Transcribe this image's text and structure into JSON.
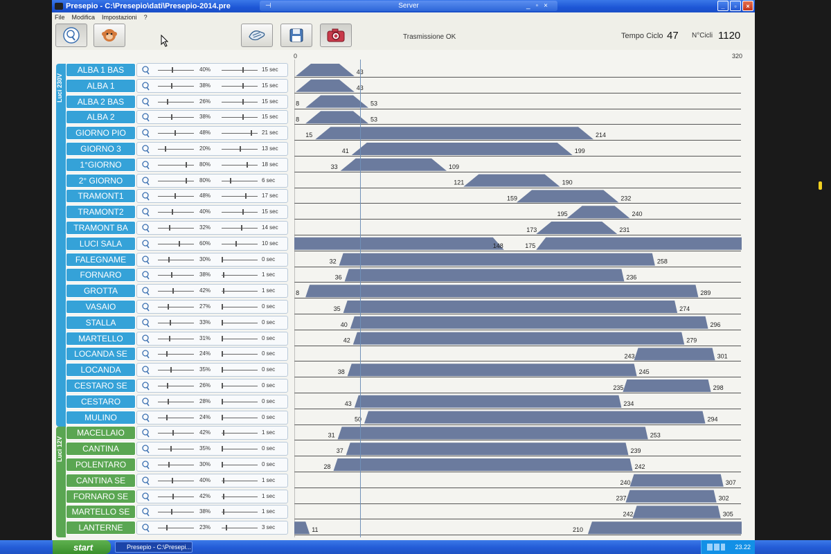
{
  "window": {
    "title": "Presepio - C:\\Presepio\\dati\\Presepio-2014.pre",
    "server_title": "Server"
  },
  "menu": [
    "File",
    "Modifica",
    "Impostazioni",
    "?"
  ],
  "toolbar": {
    "status_text": "Trasmissione OK",
    "tempo_label": "Tempo Ciclo",
    "tempo_value": "47",
    "cicli_label": "N°Cicli",
    "cicli_value": "1120",
    "icons": [
      "light-bulb-icon",
      "monkey-icon",
      "hands-icon",
      "save-disk-icon",
      "camera-icon"
    ]
  },
  "timeline": {
    "start": "0",
    "end": "320",
    "max": 320,
    "cursor": 47
  },
  "groups": [
    {
      "label": "Luci 230V",
      "color": "#35a2d8"
    },
    {
      "label": "Luci 12V",
      "color": "#5aa652"
    }
  ],
  "colors": {
    "bar": "#6b7b9e",
    "blue_channel": "#35a2d8",
    "green_channel": "#5aa652"
  },
  "channels": [
    {
      "name": "ALBA 1 BAS",
      "group": 0,
      "pct": "40%",
      "sec": "15 sec",
      "shape": "pulse",
      "start": 1,
      "end": 43,
      "lstart": "1",
      "lend": "43"
    },
    {
      "name": "ALBA 1",
      "group": 0,
      "pct": "38%",
      "sec": "15 sec",
      "shape": "pulse",
      "start": 1,
      "end": 43,
      "lstart": "1",
      "lend": "43"
    },
    {
      "name": "ALBA 2 BAS",
      "group": 0,
      "pct": "26%",
      "sec": "15 sec",
      "shape": "pulse",
      "start": 8,
      "end": 53,
      "lstart": "8",
      "lend": "53"
    },
    {
      "name": "ALBA 2",
      "group": 0,
      "pct": "38%",
      "sec": "15 sec",
      "shape": "pulse",
      "start": 8,
      "end": 53,
      "lstart": "8",
      "lend": "53"
    },
    {
      "name": "GIORNO PIO",
      "group": 0,
      "pct": "48%",
      "sec": "21 sec",
      "shape": "pulse",
      "start": 15,
      "end": 214,
      "lstart": "15",
      "lend": "214"
    },
    {
      "name": "GIORNO 3",
      "group": 0,
      "pct": "20%",
      "sec": "13 sec",
      "shape": "pulse",
      "start": 41,
      "end": 199,
      "lstart": "41",
      "lend": "199"
    },
    {
      "name": "1°GIORNO",
      "group": 0,
      "pct": "80%",
      "sec": "18 sec",
      "shape": "pulse",
      "start": 33,
      "end": 109,
      "lstart": "33",
      "lend": "109"
    },
    {
      "name": "2° GIORNO",
      "group": 0,
      "pct": "80%",
      "sec": "6 sec",
      "shape": "pulse",
      "start": 121,
      "end": 190,
      "lstart": "121",
      "lend": "190"
    },
    {
      "name": "TRAMONT1",
      "group": 0,
      "pct": "48%",
      "sec": "17 sec",
      "shape": "pulse",
      "start": 159,
      "end": 232,
      "lstart": "159",
      "lend": "232"
    },
    {
      "name": "TRAMONT2",
      "group": 0,
      "pct": "40%",
      "sec": "15 sec",
      "shape": "pulse",
      "start": 195,
      "end": 240,
      "lstart": "195",
      "lend": "240"
    },
    {
      "name": "TRAMONT BA",
      "group": 0,
      "pct": "32%",
      "sec": "14 sec",
      "shape": "pulse",
      "start": 173,
      "end": 231,
      "lstart": "173",
      "lend": "231"
    },
    {
      "name": "LUCI SALA",
      "group": 0,
      "pct": "60%",
      "sec": "10 sec",
      "shape": "dip",
      "start": 148,
      "end": 175,
      "lstart": "148",
      "lend": "175"
    },
    {
      "name": "FALEGNAME",
      "group": 0,
      "pct": "30%",
      "sec": "0 sec",
      "shape": "block",
      "start": 32,
      "end": 258,
      "lstart": "32",
      "lend": "258"
    },
    {
      "name": "FORNARO",
      "group": 0,
      "pct": "38%",
      "sec": "1 sec",
      "shape": "block",
      "start": 36,
      "end": 236,
      "lstart": "36",
      "lend": "236"
    },
    {
      "name": "GROTTA",
      "group": 0,
      "pct": "42%",
      "sec": "1 sec",
      "shape": "block",
      "start": 8,
      "end": 289,
      "lstart": "8",
      "lend": "289"
    },
    {
      "name": "VASAIO",
      "group": 0,
      "pct": "27%",
      "sec": "0 sec",
      "shape": "block",
      "start": 35,
      "end": 274,
      "lstart": "35",
      "lend": "274"
    },
    {
      "name": "STALLA",
      "group": 0,
      "pct": "33%",
      "sec": "0 sec",
      "shape": "block",
      "start": 40,
      "end": 296,
      "lstart": "40",
      "lend": "296"
    },
    {
      "name": "MARTELLO",
      "group": 0,
      "pct": "31%",
      "sec": "0 sec",
      "shape": "block",
      "start": 42,
      "end": 279,
      "lstart": "42",
      "lend": "279"
    },
    {
      "name": "LOCANDA SE",
      "group": 0,
      "pct": "24%",
      "sec": "0 sec",
      "shape": "block",
      "start": 243,
      "end": 301,
      "lstart": "243",
      "lend": "301"
    },
    {
      "name": "LOCANDA",
      "group": 0,
      "pct": "35%",
      "sec": "0 sec",
      "shape": "block",
      "start": 38,
      "end": 245,
      "lstart": "38",
      "lend": "245"
    },
    {
      "name": "CESTARO SE",
      "group": 0,
      "pct": "26%",
      "sec": "0 sec",
      "shape": "block",
      "start": 235,
      "end": 298,
      "lstart": "235",
      "lend": "298"
    },
    {
      "name": "CESTARO",
      "group": 0,
      "pct": "28%",
      "sec": "0 sec",
      "shape": "block",
      "start": 43,
      "end": 234,
      "lstart": "43",
      "lend": "234"
    },
    {
      "name": "MULINO",
      "group": 0,
      "pct": "24%",
      "sec": "0 sec",
      "shape": "block",
      "start": 50,
      "end": 294,
      "lstart": "50",
      "lend": "294"
    },
    {
      "name": "MACELLAIO",
      "group": 1,
      "pct": "42%",
      "sec": "1 sec",
      "shape": "block",
      "start": 31,
      "end": 253,
      "lstart": "31",
      "lend": "253"
    },
    {
      "name": "CANTINA",
      "group": 1,
      "pct": "35%",
      "sec": "0 sec",
      "shape": "block",
      "start": 37,
      "end": 239,
      "lstart": "37",
      "lend": "239"
    },
    {
      "name": "POLENTARO",
      "group": 1,
      "pct": "30%",
      "sec": "0 sec",
      "shape": "block",
      "start": 28,
      "end": 242,
      "lstart": "28",
      "lend": "242"
    },
    {
      "name": "CANTINA SE",
      "group": 1,
      "pct": "40%",
      "sec": "1 sec",
      "shape": "block",
      "start": 240,
      "end": 307,
      "lstart": "240",
      "lend": "307"
    },
    {
      "name": "FORNARO SE",
      "group": 1,
      "pct": "42%",
      "sec": "1 sec",
      "shape": "block",
      "start": 237,
      "end": 302,
      "lstart": "237",
      "lend": "302"
    },
    {
      "name": "MARTELLO SE",
      "group": 1,
      "pct": "38%",
      "sec": "1 sec",
      "shape": "block",
      "start": 242,
      "end": 305,
      "lstart": "242",
      "lend": "305"
    },
    {
      "name": "LANTERNE",
      "group": 1,
      "pct": "23%",
      "sec": "3 sec",
      "shape": "wrap",
      "start": 210,
      "end": 11,
      "lstart": "210",
      "lend": "11"
    }
  ],
  "taskbar": {
    "start_label": "start",
    "task_label": "Presepio - C:\\Presepi...",
    "clock": "23.22"
  }
}
